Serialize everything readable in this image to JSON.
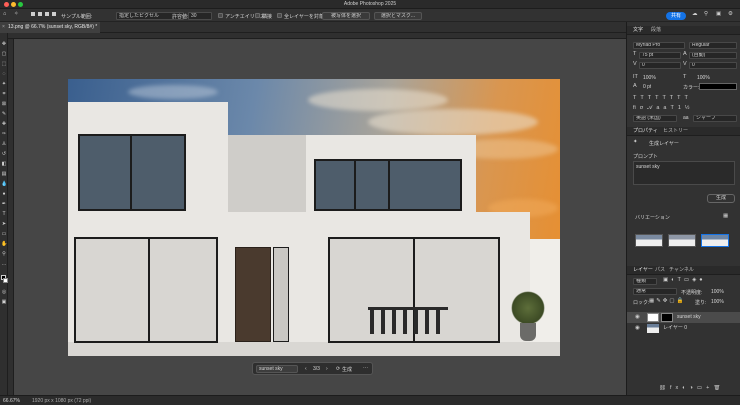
{
  "app": {
    "title": "Adobe Photoshop 2025"
  },
  "colors": {
    "accent": "#1473e6",
    "panel": "#323232",
    "canvas": "#464646"
  },
  "options_bar": {
    "sample_label": "サンプル範囲:",
    "sample_value": "指定したピクセル",
    "tolerance_label": "許容値:",
    "tolerance_value": "30",
    "antialias_label": "アンチエイリアス",
    "contiguous_label": "隣接",
    "all_layers_label": "全レイヤーを対象",
    "select_subject_label": "被写体を選択",
    "select_mask_label": "選択とマスク...",
    "share_label": "共有"
  },
  "document": {
    "tab_label": "13.png @ 66.7% (sunset sky, RGB/8#) *"
  },
  "context_bar": {
    "prompt": "sunset sky",
    "counter": "3/3",
    "generate_label": "生成"
  },
  "status": {
    "zoom": "66.67%",
    "info": "1920 px x 1080 px (72 ppi)"
  },
  "character_panel": {
    "tab_character": "文字",
    "tab_paragraph": "段落",
    "font_family": "Myriad Pro",
    "font_style": "Regular",
    "font_size": "75 pt",
    "leading": "(自動)",
    "kerning": "0",
    "tracking": "0",
    "vscale": "100%",
    "hscale": "100%",
    "baseline": "0 pt",
    "color_label": "カラー:",
    "language": "英語 (米国)",
    "aa": "シャープ"
  },
  "properties_panel": {
    "tab_properties": "プロパティ",
    "tab_history": "ヒストリー",
    "layer_type": "生成レイヤー",
    "prompt_label": "プロンプト",
    "prompt_value": "sunset sky",
    "generate_button": "生成",
    "variations_label": "バリエーション"
  },
  "layers_panel": {
    "tab_layers": "レイヤー",
    "tab_paths": "パス",
    "tab_channels": "チャンネル",
    "kind_label": "種類",
    "blend_mode": "通常",
    "opacity_label": "不透明度:",
    "opacity_value": "100%",
    "lock_label": "ロック:",
    "fill_label": "塗り:",
    "fill_value": "100%",
    "layers": [
      {
        "name": "sunset sky"
      },
      {
        "name": "レイヤー 0"
      }
    ]
  }
}
